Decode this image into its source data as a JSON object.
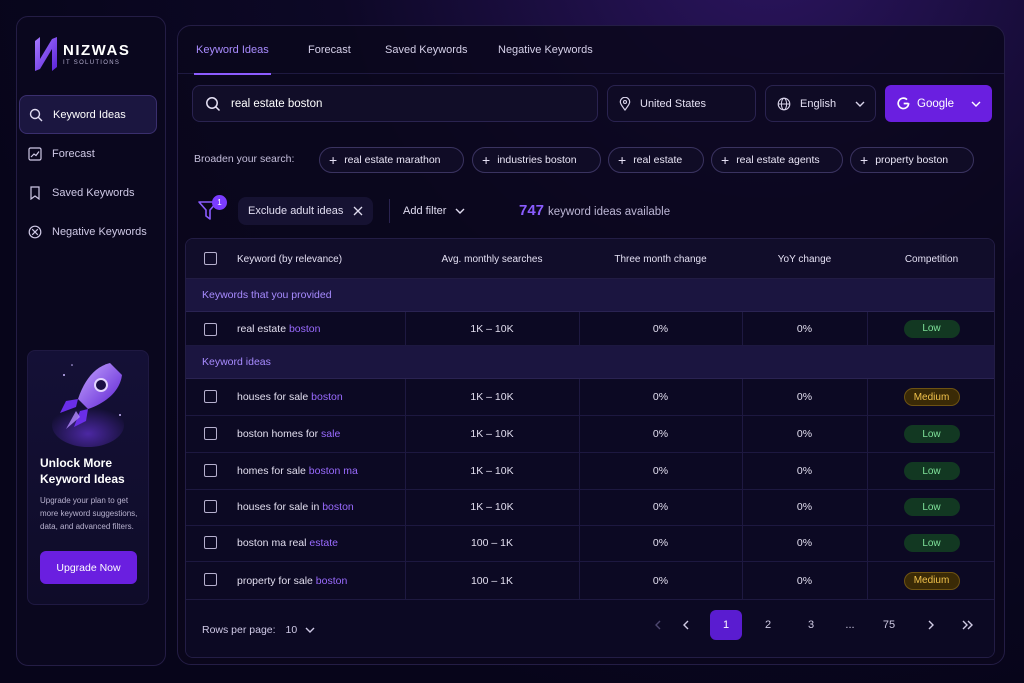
{
  "brand": {
    "name": "NIZWAS",
    "tagline": "IT SOLUTIONS"
  },
  "sidebar": {
    "items": [
      {
        "label": "Keyword Ideas",
        "icon": "search-icon"
      },
      {
        "label": "Forecast",
        "icon": "chart-line-icon"
      },
      {
        "label": "Saved Keywords",
        "icon": "bookmark-icon"
      },
      {
        "label": "Negative Keywords",
        "icon": "block-icon"
      }
    ],
    "promo": {
      "title": "Unlock More Keyword Ideas",
      "text": "Upgrade your plan to get more keyword suggestions, data, and advanced filters.",
      "button": "Upgrade Now"
    }
  },
  "tabs": [
    "Keyword Ideas",
    "Forecast",
    "Saved Keywords",
    "Negative Keywords"
  ],
  "search": {
    "value": "real estate boston",
    "location": "United States",
    "language": "English",
    "engine": "Google"
  },
  "broaden": {
    "label": "Broaden your search:",
    "chips": [
      "real estate marathon",
      "industries boston",
      "real estate",
      "real estate agents",
      "property boston"
    ]
  },
  "filters": {
    "badge": "1",
    "exclude": "Exclude adult ideas",
    "add": "Add filter",
    "count": "747",
    "count_text": "keyword ideas available"
  },
  "table": {
    "headers": [
      "Keyword (by relevance)",
      "Avg. monthly searches",
      "Three month change",
      "YoY change",
      "Competition"
    ],
    "section_provided": "Keywords that you provided",
    "section_ideas": "Keyword ideas",
    "provided": [
      {
        "kw_plain": "real estate ",
        "kw_hl": "boston",
        "searches": "1K – 10K",
        "three": "0%",
        "yoy": "0%",
        "comp": "Low"
      }
    ],
    "ideas": [
      {
        "kw_plain": "houses for sale ",
        "kw_hl": "boston",
        "searches": "1K – 10K",
        "three": "0%",
        "yoy": "0%",
        "comp": "Medium"
      },
      {
        "kw_plain": "boston homes for ",
        "kw_hl": "sale",
        "searches": "1K – 10K",
        "three": "0%",
        "yoy": "0%",
        "comp": "Low"
      },
      {
        "kw_plain": "homes for sale ",
        "kw_hl": "boston ma",
        "searches": "1K – 10K",
        "three": "0%",
        "yoy": "0%",
        "comp": "Low"
      },
      {
        "kw_plain": "houses for sale in ",
        "kw_hl": "boston",
        "searches": "1K – 10K",
        "three": "0%",
        "yoy": "0%",
        "comp": "Low"
      },
      {
        "kw_plain": "boston ma real ",
        "kw_hl": "estate",
        "searches": "100 – 1K",
        "three": "0%",
        "yoy": "0%",
        "comp": "Low"
      },
      {
        "kw_plain": "property for sale ",
        "kw_hl": "boston",
        "searches": "100 – 1K",
        "three": "0%",
        "yoy": "0%",
        "comp": "Medium"
      }
    ]
  },
  "pagination": {
    "rows_label": "Rows per page:",
    "rows_value": "10",
    "pages": [
      "1",
      "2",
      "3",
      "...",
      "75"
    ],
    "current": "1"
  },
  "colors": {
    "accent": "#6a1fe0",
    "highlight": "#9a6bff",
    "low": "#7fe29a",
    "medium": "#f1c24c"
  }
}
